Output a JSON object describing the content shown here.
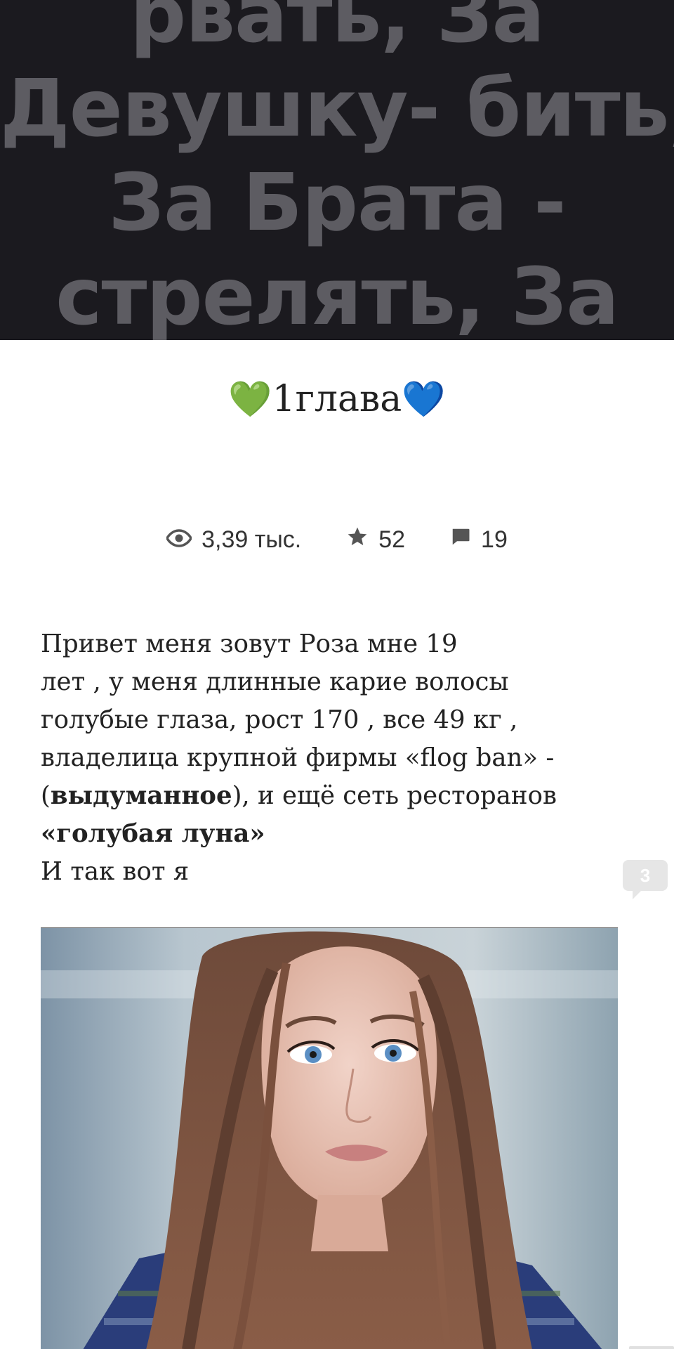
{
  "cover": {
    "lines": [
      "рвать, За",
      "Девушку- бить,",
      "За Брата -",
      "стрелять, За"
    ]
  },
  "chapter": {
    "heart_left": "💚",
    "title": "1глава",
    "heart_right": "💙"
  },
  "stats": {
    "views": "3,39 тыс.",
    "rating": "52",
    "comments": "19",
    "views_icon": "eye-icon",
    "rating_icon": "star-icon",
    "comments_icon": "comment-icon"
  },
  "story": {
    "line1": "Привет меня зовут Роза мне 19",
    "line2": "лет , у меня длинные карие волосы",
    "line3": "голубые глаза, рост 170 , все 49 кг ,",
    "line4": "владелица крупной фирмы «flog ban» -",
    "line5_open": "(",
    "line5_bold": "выдуманное",
    "line5_rest": "), и ещё сеть ресторанов",
    "line6_bold": "«голубая луна»",
    "line7": "И так вот я"
  },
  "paragraph_comments": {
    "count": "3"
  },
  "colors": {
    "cover_bg": "#1b1a1f",
    "cover_text": "#5d5c62",
    "text": "#222222",
    "badge_bg": "#e6e6e6"
  }
}
